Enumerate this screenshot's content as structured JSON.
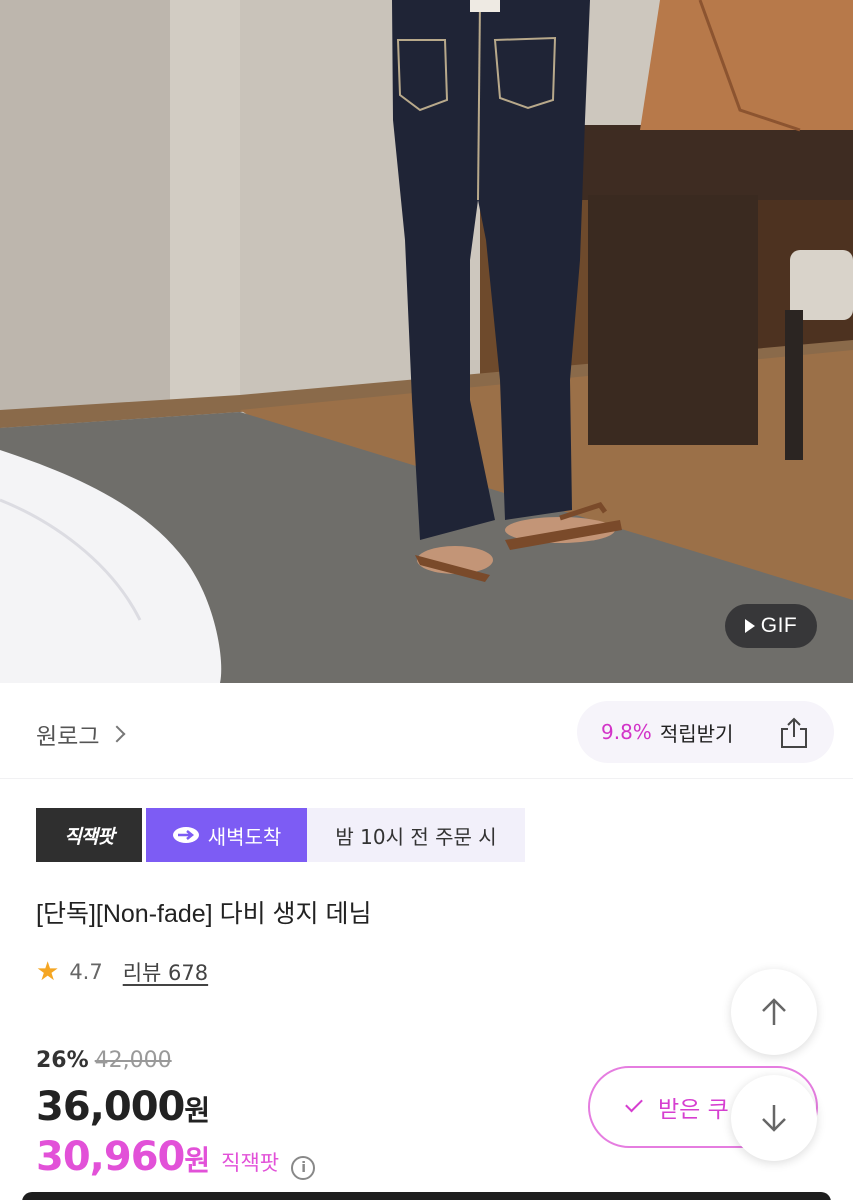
{
  "media": {
    "gif_label": "GIF"
  },
  "brand": {
    "name": "원로그"
  },
  "reward": {
    "rate": "9.8%",
    "label": "적립받기"
  },
  "badges": {
    "jjp": "직잭팟",
    "dawn": "새벽도착",
    "dawn_note": "밤 10시 전 주문 시"
  },
  "product": {
    "title": "[단독][Non-fade] 다비 생지 데님",
    "rating": "4.7",
    "reviews": "리뷰 678"
  },
  "pricing": {
    "discount_rate": "26%",
    "original_price": "42,000",
    "sale_price": "36,000",
    "currency": "원",
    "jackpot_price": "30,960",
    "jackpot_label": "직잭팟"
  },
  "coupon": {
    "label": "받은 쿠"
  },
  "icons": {
    "share": "share-icon",
    "star": "star-icon",
    "info": "info-icon",
    "scroll_up": "arrow-up-icon",
    "scroll_down": "arrow-down-icon",
    "check": "check-icon",
    "play": "play-icon",
    "chevron": "chevron-right-icon"
  },
  "colors": {
    "accent": "#e251d8",
    "dawn_purple": "#7d5cf4",
    "jackpot_dark": "#2f2f2f",
    "star": "#f5a623"
  }
}
